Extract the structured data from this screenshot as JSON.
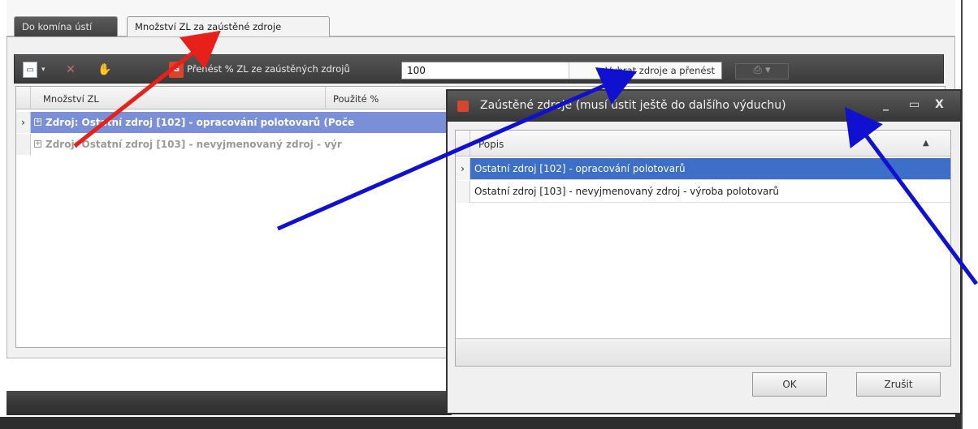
{
  "tabs": [
    {
      "label": "Do komína ústí"
    },
    {
      "label": "Množství ZL za zaústěné zdroje"
    }
  ],
  "toolbar": {
    "transfer_label": "Přenést % ZL ze zaústěných zdrojů",
    "percent_value": "100",
    "select_button": "Vybrat zdroje a přenést",
    "icons": [
      "new-document-icon",
      "delete-icon",
      "hand-icon",
      "transfer-icon"
    ]
  },
  "grid": {
    "columns": [
      "Množství ZL",
      "Použité %"
    ],
    "rows": [
      {
        "text": "Zdroj: Ostatní zdroj [102] - opracování polotovarů (Poče",
        "selected": true
      },
      {
        "text": "Zdroj: Ostatní zdroj [103] - nevyjmenovaný zdroj - výr",
        "selected": false
      }
    ]
  },
  "dialog": {
    "title": "Zaústěné zdroje (musí ústit ještě do dalšího výduchu)",
    "column": "Popis",
    "rows": [
      "Ostatní zdroj [102] - opracování polotovarů",
      "Ostatní zdroj [103] - nevyjmenovaný zdroj - výroba polotovarů"
    ],
    "ok_label": "OK",
    "cancel_label": "Zrušit",
    "controls": {
      "minimize": "_",
      "maximize": "▭",
      "close": "X"
    }
  },
  "colors": {
    "selected_row": "#7a8fd8",
    "dialog_selected_row": "#3d6fc9",
    "annotation_red": "#e8201a",
    "annotation_blue": "#1010d0"
  }
}
